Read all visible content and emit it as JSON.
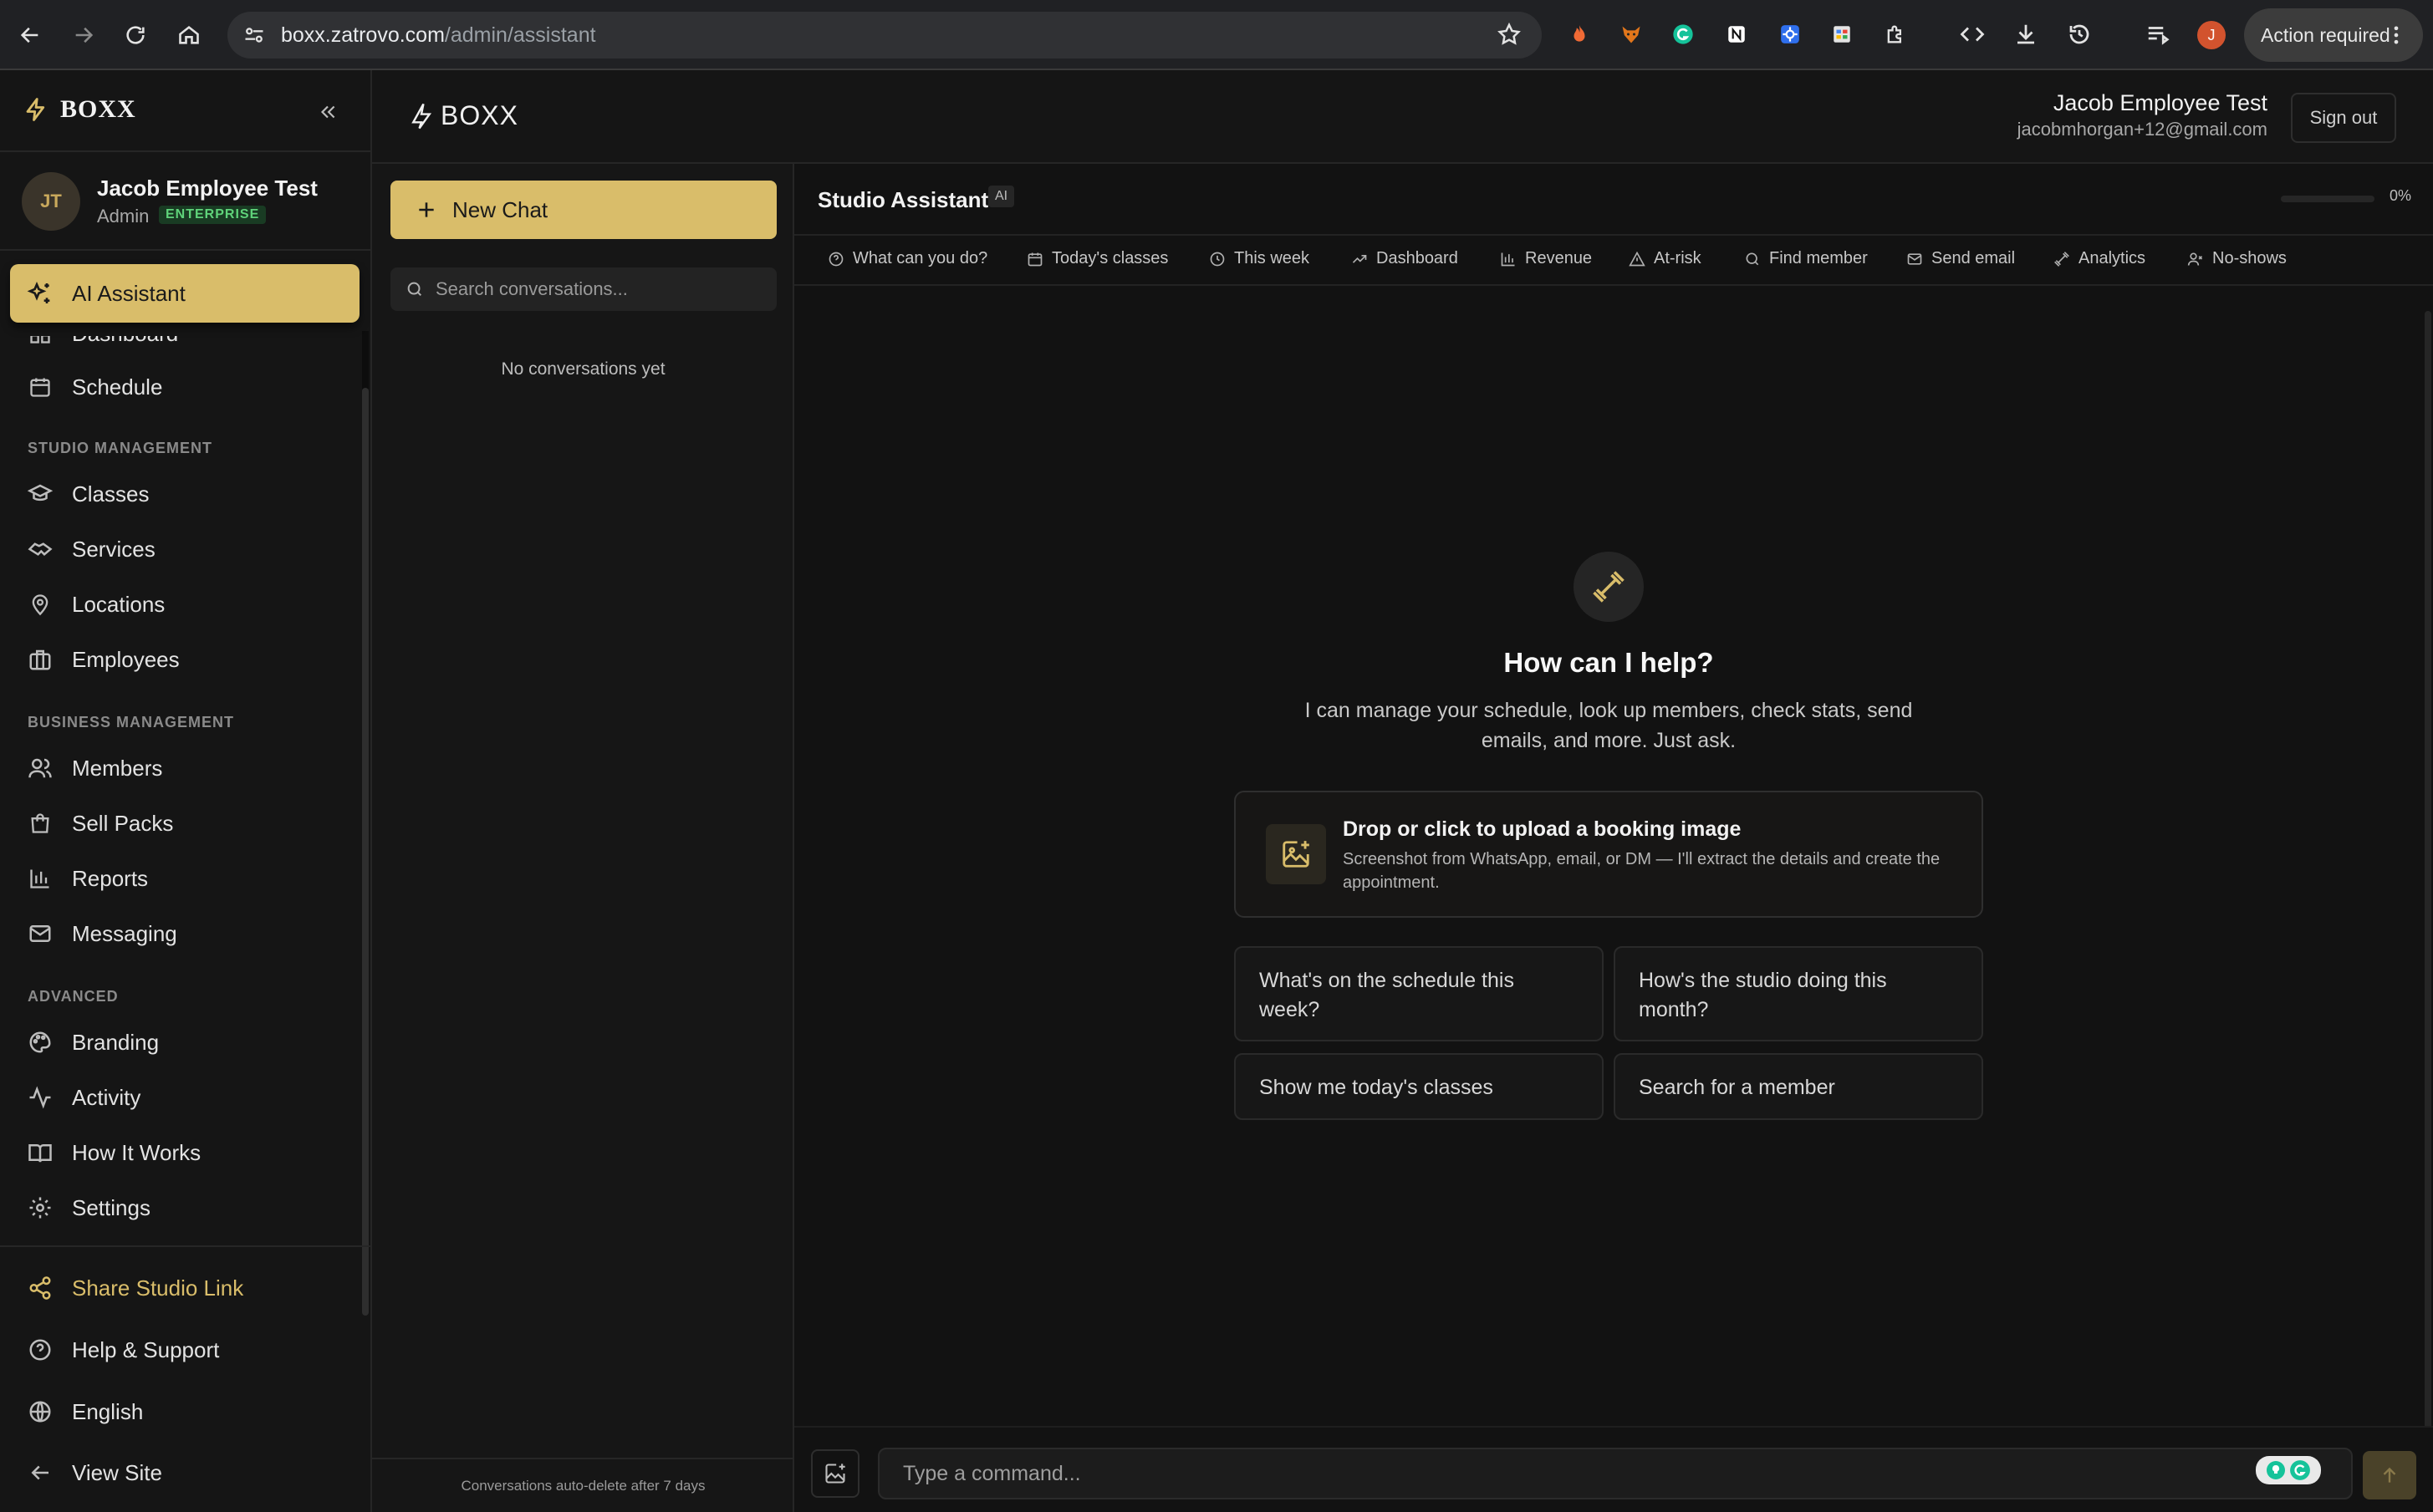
{
  "browser": {
    "url_host": "boxx.zatrovo.com",
    "url_path": "/admin/assistant",
    "profile_initial": "J",
    "action_required": "Action required"
  },
  "sidebar": {
    "brand": "BOXX",
    "user": {
      "initials": "JT",
      "name": "Jacob Employee Test",
      "role": "Admin",
      "plan": "ENTERPRISE"
    },
    "active_item": "AI Assistant",
    "top_items": [
      {
        "label": "Dashboard",
        "icon": "dashboard-icon"
      },
      {
        "label": "Schedule",
        "icon": "calendar-icon"
      }
    ],
    "sections": [
      {
        "label": "STUDIO MANAGEMENT",
        "items": [
          "Classes",
          "Services",
          "Locations",
          "Employees"
        ]
      },
      {
        "label": "BUSINESS MANAGEMENT",
        "items": [
          "Members",
          "Sell Packs",
          "Reports",
          "Messaging"
        ]
      },
      {
        "label": "ADVANCED",
        "items": [
          "Branding",
          "Activity",
          "How It Works",
          "Settings"
        ]
      }
    ],
    "footer": [
      "Share Studio Link",
      "Help & Support",
      "English",
      "View Site"
    ]
  },
  "header": {
    "logo": "BOXX",
    "user_name": "Jacob Employee Test",
    "user_email": "jacobmhorgan+12@gmail.com",
    "sign_out": "Sign out"
  },
  "conversations": {
    "new_chat": "New Chat",
    "search_placeholder": "Search conversations...",
    "empty": "No conversations yet",
    "auto_delete": "Conversations auto-delete after 7 days"
  },
  "assistant": {
    "title": "Studio Assistant",
    "badge": "AI",
    "usage_percent": "0%",
    "usage_fraction": 0,
    "quick_actions": [
      "What can you do?",
      "Today's classes",
      "This week",
      "Dashboard",
      "Revenue",
      "At-risk",
      "Find member",
      "Send email",
      "Analytics",
      "No-shows"
    ],
    "help_title": "How can I help?",
    "help_desc": "I can manage your schedule, look up members, check stats, send emails, and more. Just ask.",
    "upload_title": "Drop or click to upload a booking image",
    "upload_desc": "Screenshot from WhatsApp, email, or DM — I'll extract the details and create the appointment.",
    "suggestions": [
      "What's on the schedule this week?",
      "How's the studio doing this month?",
      "Show me today's classes",
      "Search for a member"
    ],
    "input_placeholder": "Type a command..."
  },
  "colors": {
    "accent": "#d9bd6a",
    "background": "#121212",
    "panel": "#161616"
  }
}
